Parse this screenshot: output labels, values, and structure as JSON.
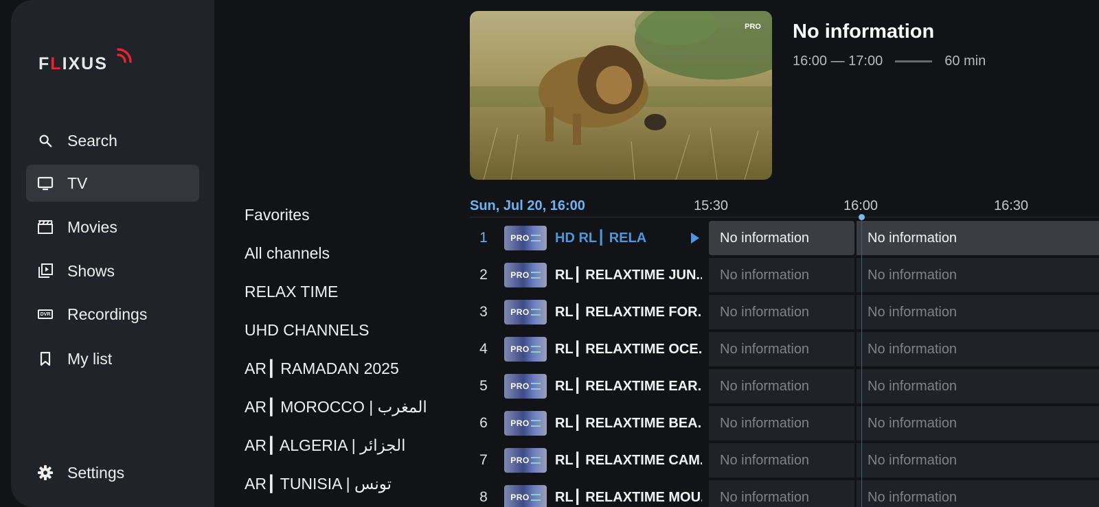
{
  "app": {
    "logo_pre": "F",
    "logo_l": "L",
    "logo_post": "IXUS"
  },
  "sidebar": {
    "items": [
      {
        "label": "Search",
        "icon": "search-icon"
      },
      {
        "label": "TV",
        "icon": "tv-icon",
        "active": true
      },
      {
        "label": "Movies",
        "icon": "clapperboard-icon"
      },
      {
        "label": "Shows",
        "icon": "play-library-icon"
      },
      {
        "label": "Recordings",
        "icon": "dvr-icon"
      },
      {
        "label": "My list",
        "icon": "bookmark-icon"
      }
    ],
    "settings_label": "Settings",
    "dvr_badge": "DVR"
  },
  "categories": [
    "Favorites",
    "All channels",
    "RELAX TIME",
    "UHD CHANNELS",
    "AR┃ RAMADAN 2025",
    "AR┃ MOROCCO | المغرب",
    "AR┃ ALGERIA | الجزائر",
    "AR┃ TUNISIA | تونس"
  ],
  "program": {
    "title": "No information",
    "time_range": "16:00 — 17:00",
    "duration": "60 min",
    "preview_badge": "PRO"
  },
  "timeline": {
    "date": "Sun, Jul 20, 16:00",
    "ticks": [
      "15:30",
      "16:00",
      "16:30"
    ]
  },
  "channels": [
    {
      "num": "1",
      "name": "HD      RL┃ RELA",
      "active": true,
      "p1": "No information",
      "p2": "No information"
    },
    {
      "num": "2",
      "name": "RL┃ RELAXTIME JUN..",
      "p1": "No information",
      "p2": "No information"
    },
    {
      "num": "3",
      "name": "RL┃ RELAXTIME FOR..",
      "p1": "No information",
      "p2": "No information"
    },
    {
      "num": "4",
      "name": "RL┃ RELAXTIME OCE..",
      "p1": "No information",
      "p2": "No information"
    },
    {
      "num": "5",
      "name": "RL┃ RELAXTIME EAR..",
      "p1": "No information",
      "p2": "No information"
    },
    {
      "num": "6",
      "name": "RL┃  RELAXTIME BEA..",
      "p1": "No information",
      "p2": "No information"
    },
    {
      "num": "7",
      "name": "RL┃ RELAXTIME CAM..",
      "p1": "No information",
      "p2": "No information"
    },
    {
      "num": "8",
      "name": "RL┃ RELAXTIME MOU..",
      "p1": "No information",
      "p2": "No information"
    }
  ],
  "channel_logo_text": "PRO",
  "colors": {
    "accent": "#6fb2f2",
    "logo_red": "#e3262f",
    "sidebar_bg": "#202327",
    "active_item": "#33373c"
  }
}
